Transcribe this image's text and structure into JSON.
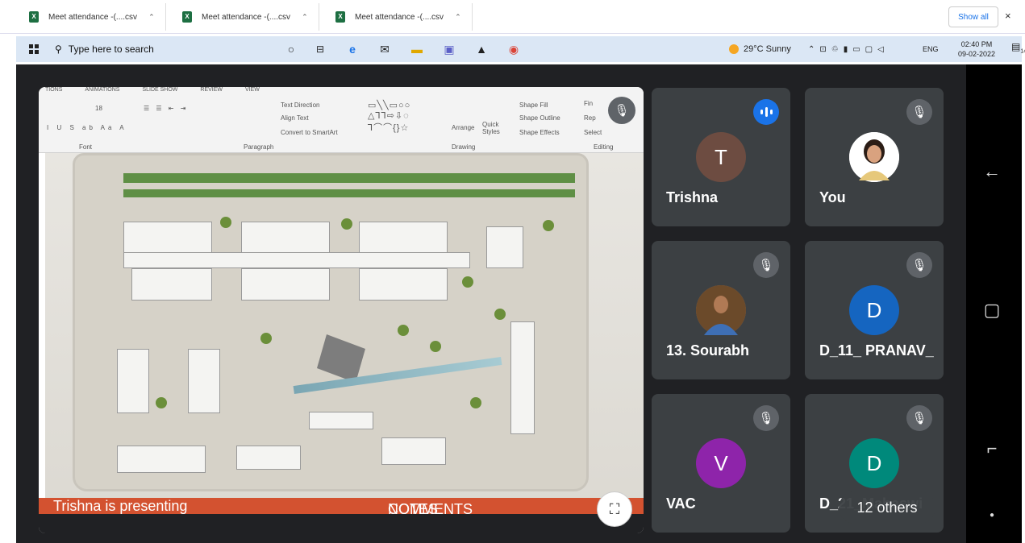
{
  "downloads": {
    "items": [
      {
        "label": "Meet attendance -(....csv"
      },
      {
        "label": "Meet attendance -(....csv"
      },
      {
        "label": "Meet attendance -(....csv"
      }
    ],
    "show_all": "Show all",
    "close": "×"
  },
  "taskbar": {
    "search_placeholder": "Type here to search",
    "weather": "29°C Sunny",
    "lang": "ENG",
    "time": "02:40 PM",
    "date": "09-02-2022",
    "notif_count": "14"
  },
  "slide": {
    "ribbon_tabs": [
      "TIONS",
      "ANIMATIONS",
      "SLIDE SHOW",
      "REVIEW",
      "VIEW"
    ],
    "ribbon_font_size": "18",
    "ribbon_text_direction": "Text Direction",
    "ribbon_align_text": "Align Text",
    "ribbon_convert": "Convert to SmartArt",
    "ribbon_shape_fill": "Shape Fill",
    "ribbon_shape_outline": "Shape Outline",
    "ribbon_shape_effects": "Shape Effects",
    "ribbon_arrange": "Arrange",
    "ribbon_quick_styles": "Quick Styles",
    "ribbon_find": "Fin",
    "ribbon_replace": "Rep",
    "ribbon_select": "Select",
    "group_font": "Font",
    "group_paragraph": "Paragraph",
    "group_drawing": "Drawing",
    "group_editing": "Editing",
    "presenting": "Trishna is presenting",
    "status_notes": "NOTES",
    "status_comments": "COMMENTS"
  },
  "tiles": [
    {
      "initial": "T",
      "name": "Trishna",
      "color": "#6d4c41",
      "speaking": true
    },
    {
      "initial": "",
      "name": "You",
      "color": "#ffffff",
      "speaking": false
    },
    {
      "initial": "",
      "name": "13. Sourabh",
      "color": "#8d6e63",
      "speaking": false
    },
    {
      "initial": "D",
      "name": "D_11_ PRANAV_",
      "color": "#1565c0",
      "speaking": false
    },
    {
      "initial": "V",
      "name": "VAC",
      "color": "#8e24aa",
      "speaking": false
    },
    {
      "initial": "D",
      "name": "D_21_Mahaswi",
      "color": "#00897b",
      "speaking": false
    }
  ],
  "others": "12 others",
  "icons": {
    "mic_off": "mic-off-icon",
    "expand": "expand-icon",
    "back": "back-icon",
    "home": "home-icon",
    "recents": "recents-icon"
  }
}
